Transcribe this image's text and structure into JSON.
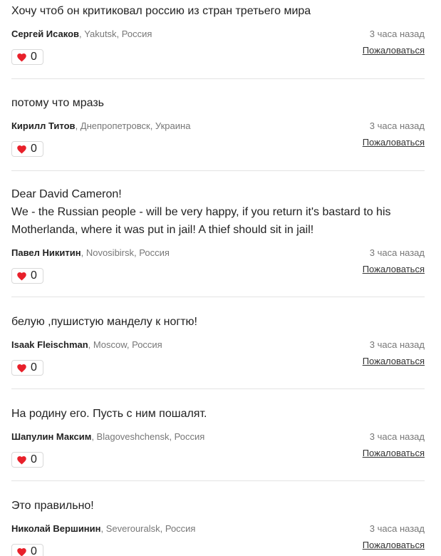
{
  "comments": [
    {
      "text": "Хочу чтоб он критиковал россию из стран третьего мира",
      "author": "Сергей Исаков",
      "location": "Yakutsk, Россия",
      "time": "3 часа назад",
      "likes": "0",
      "report_label": "Пожаловаться"
    },
    {
      "text": "потому что мразь",
      "author": "Кирилл Титов",
      "location": "Днепропетровск, Украина",
      "time": "3 часа назад",
      "likes": "0",
      "report_label": "Пожаловаться"
    },
    {
      "text": "Dear David Cameron!\nWe - the Russian people - will be very happy, if you return it's bastard to his Motherlanda, where it was put in jail! A thief should sit in jail!",
      "author": "Павел Никитин",
      "location": "Novosibirsk, Россия",
      "time": "3 часа назад",
      "likes": "0",
      "report_label": "Пожаловаться"
    },
    {
      "text": "белую ,пушистую манделу к ногтю!",
      "author": "Isaak Fleischman",
      "location": "Moscow, Россия",
      "time": "3 часа назад",
      "likes": "0",
      "report_label": "Пожаловаться"
    },
    {
      "text": "На родину его. Пусть с ним пошалят.",
      "author": "Шапулин Максим",
      "location": "Blagoveshchensk, Россия",
      "time": "3 часа назад",
      "likes": "0",
      "report_label": "Пожаловаться"
    },
    {
      "text": "Это правильно!",
      "author": "Николай Вершинин",
      "location": "Severouralsk, Россия",
      "time": "3 часа назад",
      "likes": "0",
      "report_label": "Пожаловаться"
    }
  ],
  "colors": {
    "heart": "#e8202a",
    "divider": "#e3e3e3",
    "muted_text": "#777777"
  },
  "icons": {
    "like": "heart-icon"
  }
}
